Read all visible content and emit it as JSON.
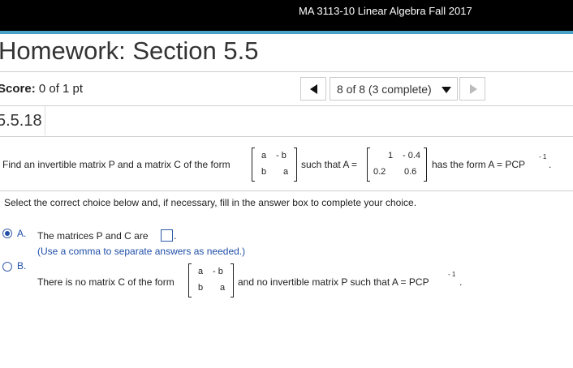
{
  "header": {
    "course_title": "MA 3113-10 Linear Algebra Fall 2017"
  },
  "homework": {
    "title": "Homework: Section 5.5"
  },
  "score": {
    "label": "Score:",
    "value": "0 of 1 pt"
  },
  "navigation": {
    "progress_text": "8 of 8 (3 complete)"
  },
  "question": {
    "number": "5.5.18",
    "prompt": {
      "before": "Find an invertible matrix P and a matrix C of the form",
      "middle": "such that A =",
      "after": "has the form A = PCP",
      "exponent": "- 1",
      "end_period": "."
    },
    "form_matrix": {
      "r1c1": "a",
      "r1c2": "- b",
      "r2c1": "b",
      "r2c2": "a"
    },
    "a_matrix": {
      "r1c1": "1",
      "r1c2": "- 0.4",
      "r2c1": "0.2",
      "r2c2": "0.6"
    },
    "instruction": "Select the correct choice below and, if necessary, fill in the answer box to complete your choice."
  },
  "choices": {
    "a": {
      "letter": "A.",
      "text": "The matrices P and C are",
      "period": ".",
      "note": "(Use a comma to separate answers as needed.)",
      "selected": true
    },
    "b": {
      "letter": "B.",
      "text_before": "There is no matrix C of the form",
      "text_after": "and no invertible matrix P such that A = PCP",
      "exponent": "- 1",
      "period": ".",
      "selected": false
    }
  },
  "colors": {
    "header_bg": "#000000",
    "accent_line": "#4aa3c7",
    "choice_blue": "#1f4fa8"
  }
}
